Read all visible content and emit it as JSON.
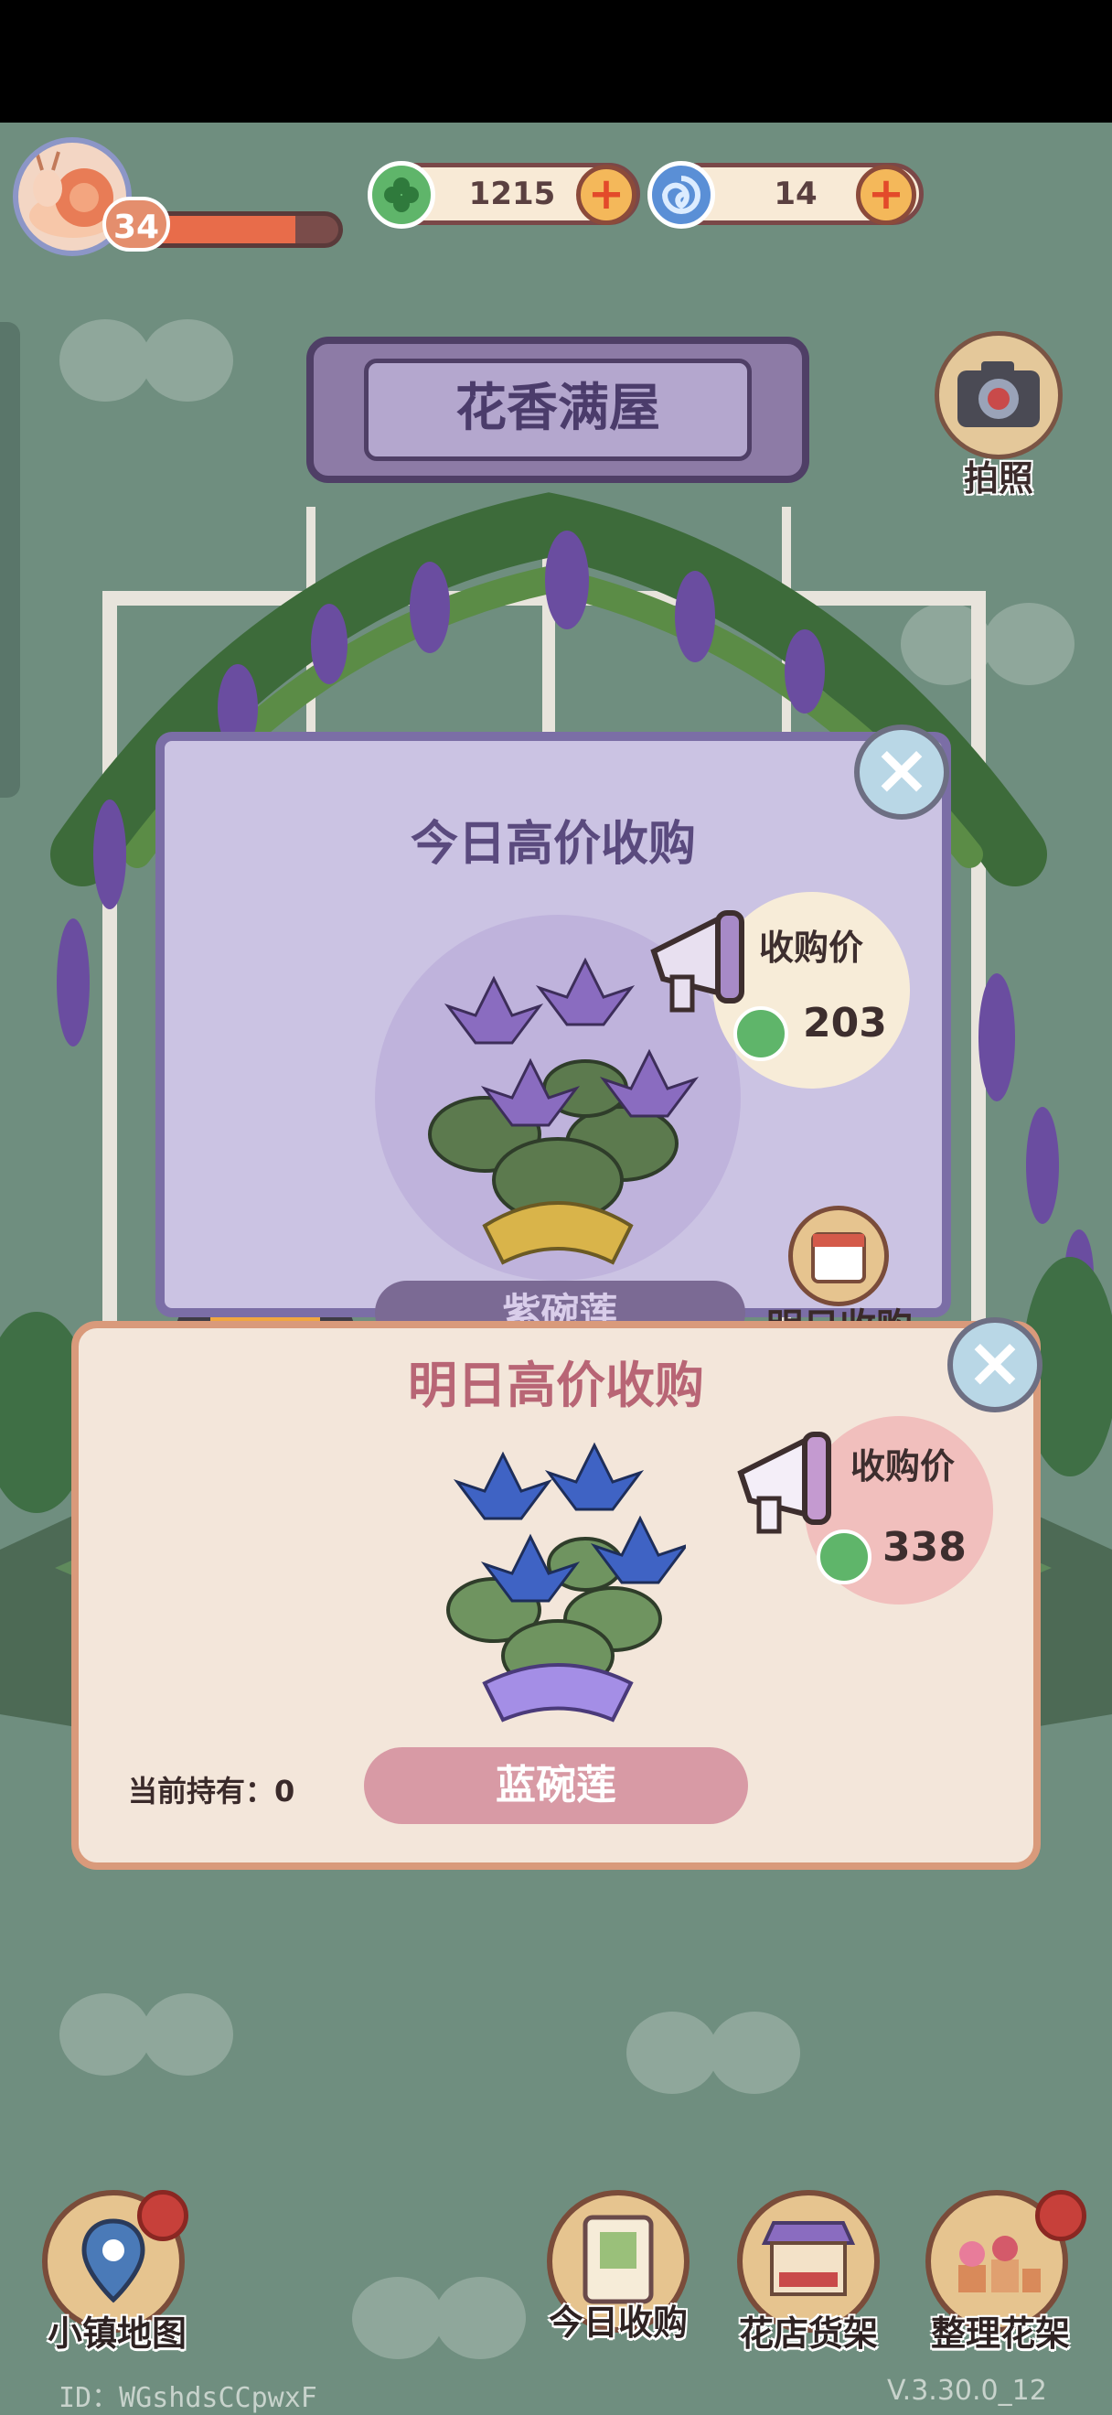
{
  "player": {
    "level": "34",
    "xp_fraction": 0.78
  },
  "currencies": [
    {
      "name": "clover",
      "value": "1215",
      "icon": "clover-coin-icon",
      "color": "#5fb56a"
    },
    {
      "name": "swirl",
      "value": "14",
      "icon": "blue-swirl-gem-icon",
      "color": "#5a8fd6"
    }
  ],
  "shop": {
    "title": "花香满屋"
  },
  "camera": {
    "label": "拍照",
    "icon": "camera-icon"
  },
  "today_panel": {
    "title": "今日高价收购",
    "price_label": "收购价",
    "price": "203",
    "plant_name": "紫碗莲",
    "tomorrow_button_label": "明日收购"
  },
  "tomorrow_panel": {
    "title": "明日高价收购",
    "price_label": "收购价",
    "price": "338",
    "holding_label": "当前持有：0",
    "plant_name": "蓝碗莲"
  },
  "bottom_nav": {
    "map": "小镇地图",
    "today_purchase": "今日收购",
    "shop_shelf": "花店货架",
    "arrange_shelf": "整理花架"
  },
  "footer": {
    "user_id": "ID：WGshdsCCpwxF",
    "version": "V.3.30.0_12"
  }
}
